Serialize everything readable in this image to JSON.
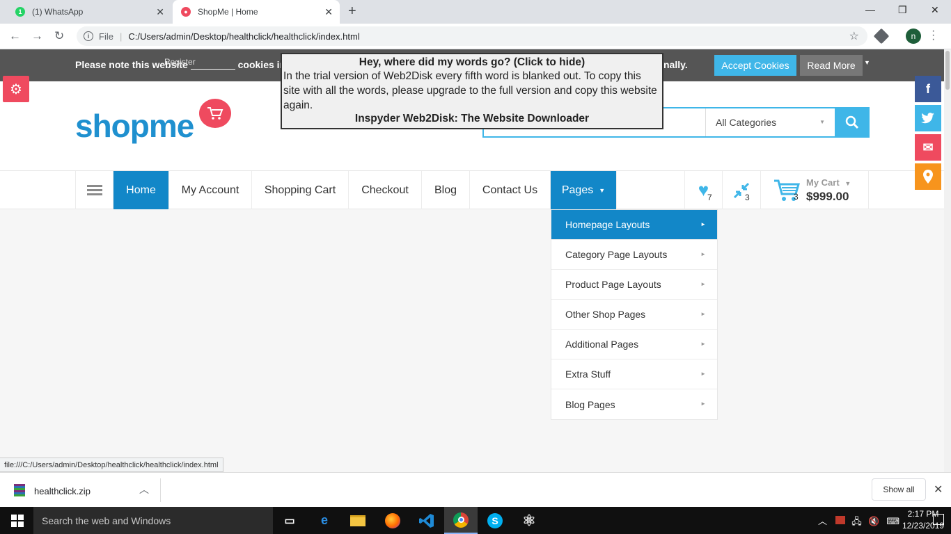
{
  "browser": {
    "tabs": [
      {
        "label": "(1) WhatsApp",
        "badge": "1"
      },
      {
        "label": "ShopMe | Home"
      }
    ],
    "new_tab": "+",
    "window_controls": {
      "minimize": "—",
      "maximize": "❐",
      "close": "✕"
    },
    "url_prefix": "File",
    "url": "C:/Users/admin/Desktop/healthclick/healthclick/index.html",
    "profile_initial": "n",
    "status_url": "file:///C:/Users/admin/Desktop/healthclick/healthclick/index.html"
  },
  "cookie_bar": {
    "text_start": "Please note this website",
    "text_mid": "cookies in o",
    "register": "Register",
    "text_end": "nally.",
    "accept": "Accept Cookies",
    "read_more": "Read More"
  },
  "popup": {
    "title": "Hey, where did my words go? (Click to hide)",
    "body": "In the trial version of Web2Disk every fifth word is blanked out. To copy this site with all the words, please upgrade to the full version and copy this website again.",
    "footer": "Inspyder Web2Disk: The Website Downloader"
  },
  "header": {
    "logo": "shopme",
    "search_placeholder": "",
    "category": "All Categories"
  },
  "nav": {
    "items": [
      "Home",
      "My Account",
      "Shopping Cart",
      "Checkout",
      "Blog",
      "Contact Us",
      "Pages"
    ],
    "wishlist_count": "7",
    "compare_count": "3",
    "cart_count": "3",
    "cart_label": "My Cart",
    "cart_total": "$999.00"
  },
  "pages_dropdown": [
    "Homepage Layouts",
    "Category Page Layouts",
    "Product Page Layouts",
    "Other Shop Pages",
    "Additional Pages",
    "Extra Stuff",
    "Blog Pages"
  ],
  "social": [
    {
      "name": "facebook",
      "glyph": "f",
      "color": "#3b5998"
    },
    {
      "name": "twitter",
      "glyph": "t",
      "color": "#3fb6e8"
    },
    {
      "name": "email",
      "glyph": "✉",
      "color": "#ef4a5f"
    },
    {
      "name": "location",
      "glyph": "⚲",
      "color": "#f7941d"
    }
  ],
  "download": {
    "file": "healthclick.zip",
    "show_all": "Show all"
  },
  "taskbar": {
    "search": "Search the web and Windows",
    "time": "2:17 PM",
    "date": "12/23/2019"
  }
}
